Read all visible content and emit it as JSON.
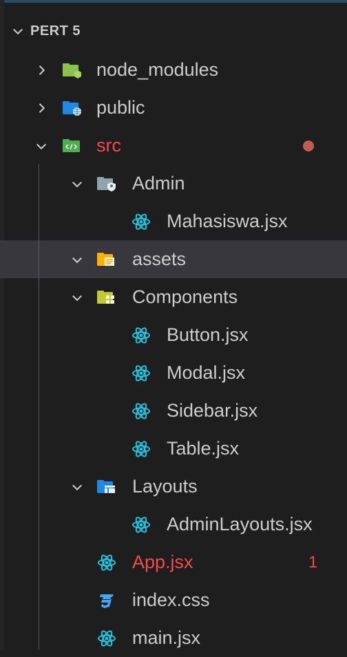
{
  "explorer": {
    "section_title": "PERT 5",
    "items": [
      {
        "label": "node_modules"
      },
      {
        "label": "public"
      },
      {
        "label": "src"
      },
      {
        "label": "Admin"
      },
      {
        "label": "Mahasiswa.jsx"
      },
      {
        "label": "assets"
      },
      {
        "label": "Components"
      },
      {
        "label": "Button.jsx"
      },
      {
        "label": "Modal.jsx"
      },
      {
        "label": "Sidebar.jsx"
      },
      {
        "label": "Table.jsx"
      },
      {
        "label": "Layouts"
      },
      {
        "label": "AdminLayouts.jsx"
      },
      {
        "label": "App.jsx",
        "badge": "1"
      },
      {
        "label": "index.css"
      },
      {
        "label": "main.jsx"
      }
    ]
  },
  "colors": {
    "background": "#1e1e1e",
    "hover_row": "#37373d",
    "error_text": "#f14c4c",
    "react_icon": "#22c5e0",
    "css_icon": "#42a5f5"
  },
  "icons": {
    "expand": "chevron-down-icon",
    "collapse": "chevron-right-icon",
    "react_file": "react-icon",
    "css_file": "css-icon"
  }
}
